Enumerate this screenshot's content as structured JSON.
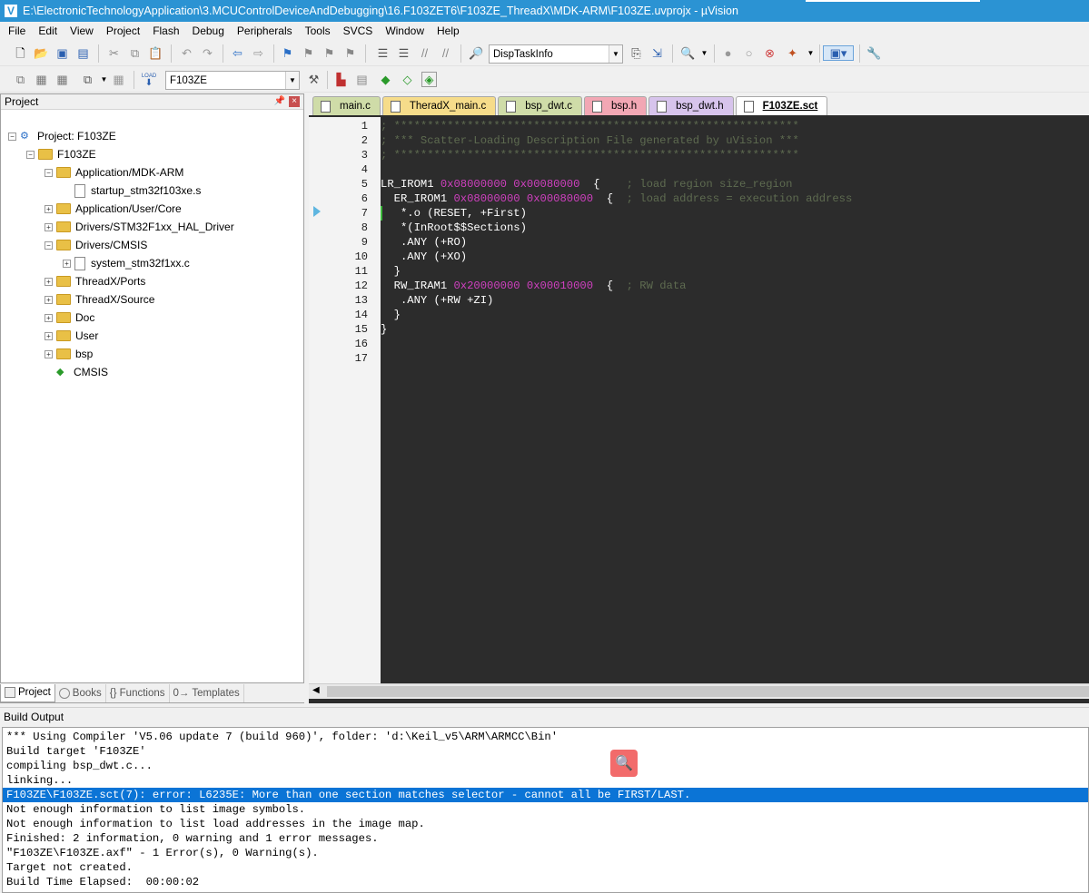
{
  "title": "E:\\ElectronicTechnologyApplication\\3.MCUControlDeviceAndDebugging\\16.F103ZET6\\F103ZE_ThreadX\\MDK-ARM\\F103ZE.uvprojx - µVision",
  "menu": [
    "File",
    "Edit",
    "View",
    "Project",
    "Flash",
    "Debug",
    "Peripherals",
    "Tools",
    "SVCS",
    "Window",
    "Help"
  ],
  "toolbar1": {
    "combo_value": "DispTaskInfo"
  },
  "toolbar2": {
    "target_value": "F103ZE",
    "load_label": "LOAD"
  },
  "project_panel": {
    "header": "Project",
    "tree": [
      {
        "label": "Project: F103ZE",
        "level": 0,
        "kind": "project",
        "expander": "−"
      },
      {
        "label": "F103ZE",
        "level": 1,
        "kind": "target",
        "expander": "−"
      },
      {
        "label": "Application/MDK-ARM",
        "level": 2,
        "kind": "folder",
        "expander": "−"
      },
      {
        "label": "startup_stm32f103xe.s",
        "level": 3,
        "kind": "file",
        "expander": ""
      },
      {
        "label": "Application/User/Core",
        "level": 2,
        "kind": "folder",
        "expander": "+"
      },
      {
        "label": "Drivers/STM32F1xx_HAL_Driver",
        "level": 2,
        "kind": "folder",
        "expander": "+"
      },
      {
        "label": "Drivers/CMSIS",
        "level": 2,
        "kind": "folder",
        "expander": "−"
      },
      {
        "label": "system_stm32f1xx.c",
        "level": 3,
        "kind": "file",
        "expander": "+"
      },
      {
        "label": "ThreadX/Ports",
        "level": 2,
        "kind": "folder",
        "expander": "+"
      },
      {
        "label": "ThreadX/Source",
        "level": 2,
        "kind": "folder",
        "expander": "+"
      },
      {
        "label": "Doc",
        "level": 2,
        "kind": "folder",
        "expander": "+"
      },
      {
        "label": "User",
        "level": 2,
        "kind": "folder",
        "expander": "+"
      },
      {
        "label": "bsp",
        "level": 2,
        "kind": "folder",
        "expander": "+"
      },
      {
        "label": "CMSIS",
        "level": 2,
        "kind": "cmsis",
        "expander": ""
      }
    ],
    "bottom_tabs": [
      "Project",
      "Books",
      "{} Functions",
      "0→ Templates"
    ]
  },
  "editor": {
    "tabs": [
      {
        "label": "main.c",
        "color": "#cfdca8"
      },
      {
        "label": "TheradX_main.c",
        "color": "#f6dc8a"
      },
      {
        "label": "bsp_dwt.c",
        "color": "#cfdca8"
      },
      {
        "label": "bsp.h",
        "color": "#f2a7b4"
      },
      {
        "label": "bsp_dwt.h",
        "color": "#d7c4ec"
      },
      {
        "label": "F103ZE.sct",
        "color": "#ffffff"
      }
    ],
    "line_numbers": [
      "1",
      "2",
      "3",
      "4",
      "5",
      "6",
      "7",
      "8",
      "9",
      "10",
      "11",
      "12",
      "13",
      "14",
      "15",
      "16",
      "17"
    ],
    "lines": [
      [
        {
          "t": "; *************************************************************",
          "c": "cmt"
        }
      ],
      [
        {
          "t": "; *** Scatter-Loading Description File generated by uVision ***",
          "c": "cmt"
        }
      ],
      [
        {
          "t": "; *************************************************************",
          "c": "cmt"
        }
      ],
      [],
      [
        {
          "t": "LR_IROM1 ",
          "c": "tok"
        },
        {
          "t": "0x08000000",
          "c": "num"
        },
        {
          "t": " ",
          "c": "tok"
        },
        {
          "t": "0x00080000",
          "c": "num"
        },
        {
          "t": "  {    ",
          "c": "tok"
        },
        {
          "t": "; load region size_region",
          "c": "cmt"
        }
      ],
      [
        {
          "t": "  ER_IROM1 ",
          "c": "tok"
        },
        {
          "t": "0x08000000",
          "c": "num"
        },
        {
          "t": " ",
          "c": "tok"
        },
        {
          "t": "0x00080000",
          "c": "num"
        },
        {
          "t": "  {  ",
          "c": "tok"
        },
        {
          "t": "; load address = execution address",
          "c": "cmt"
        }
      ],
      [
        {
          "t": "   *.o (RESET, +First)",
          "c": "tok"
        }
      ],
      [
        {
          "t": "   *(InRoot$$Sections)",
          "c": "tok"
        }
      ],
      [
        {
          "t": "   .ANY (+RO)",
          "c": "tok"
        }
      ],
      [
        {
          "t": "   .ANY (+XO)",
          "c": "tok"
        }
      ],
      [
        {
          "t": "  }",
          "c": "tok"
        }
      ],
      [
        {
          "t": "  RW_IRAM1 ",
          "c": "tok"
        },
        {
          "t": "0x20000000",
          "c": "num"
        },
        {
          "t": " ",
          "c": "tok"
        },
        {
          "t": "0x00010000",
          "c": "num"
        },
        {
          "t": "  {  ",
          "c": "tok"
        },
        {
          "t": "; RW data",
          "c": "cmt"
        }
      ],
      [
        {
          "t": "   .ANY (+RW +ZI)",
          "c": "tok"
        }
      ],
      [
        {
          "t": "  }",
          "c": "tok"
        }
      ],
      [
        {
          "t": "}",
          "c": "tok"
        }
      ],
      [],
      []
    ]
  },
  "build_output": {
    "header": "Build Output",
    "lines": [
      "*** Using Compiler 'V5.06 update 7 (build 960)', folder: 'd:\\Keil_v5\\ARM\\ARMCC\\Bin'",
      "Build target 'F103ZE'",
      "compiling bsp_dwt.c...",
      "linking...",
      "F103ZE\\F103ZE.sct(7): error: L6235E: More than one section matches selector - cannot all be FIRST/LAST.",
      "Not enough information to list image symbols.",
      "Not enough information to list load addresses in the image map.",
      "Finished: 2 information, 0 warning and 1 error messages.",
      "\"F103ZE\\F103ZE.axf\" - 1 Error(s), 0 Warning(s).",
      "Target not created.",
      "Build Time Elapsed:  00:00:02"
    ],
    "selected_index": 4
  }
}
